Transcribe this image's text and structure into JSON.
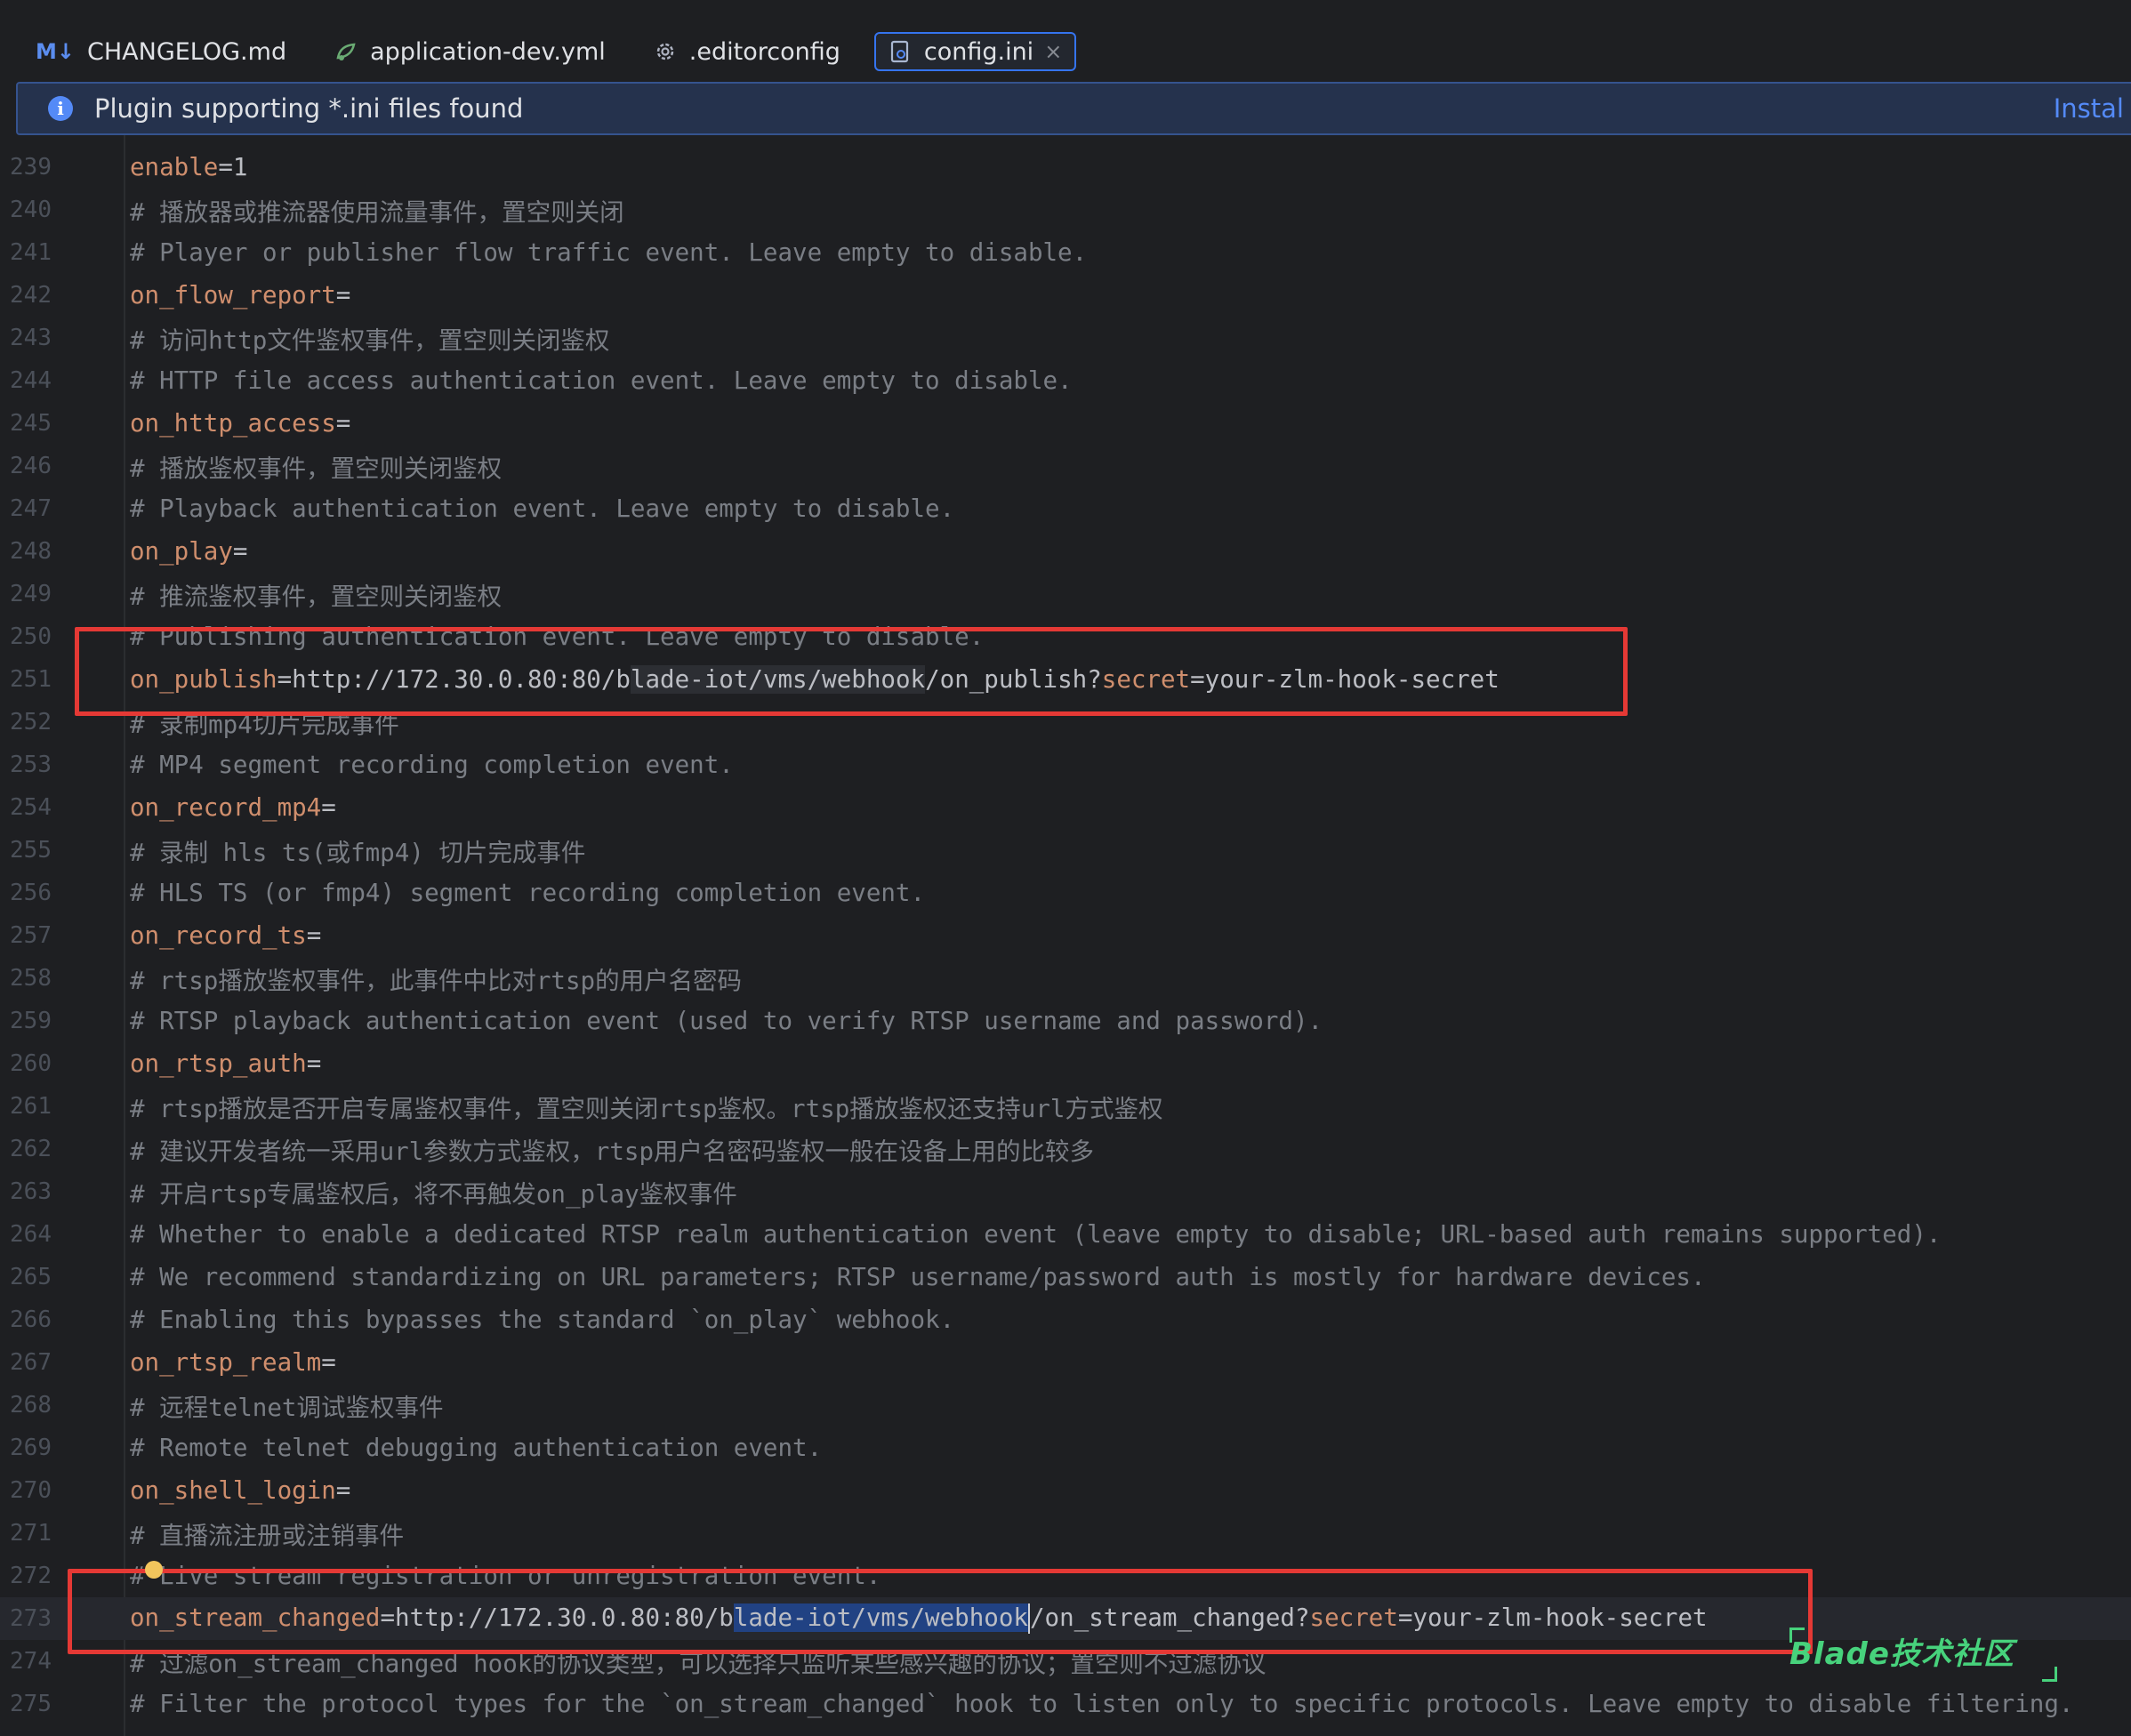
{
  "tabs": [
    {
      "label": "CHANGELOG.md",
      "icon": "markdown-icon",
      "icon_text": "M↓",
      "active": false
    },
    {
      "label": "application-dev.yml",
      "icon": "yaml-icon",
      "icon_text": "",
      "active": false
    },
    {
      "label": ".editorconfig",
      "icon": "gear-icon",
      "icon_text": "",
      "active": false
    },
    {
      "label": "config.ini",
      "icon": "ini-file-icon",
      "icon_text": "",
      "active": true
    }
  ],
  "banner": {
    "message": "Plugin supporting *.ini files found",
    "action": "Instal"
  },
  "lines": [
    {
      "n": "239",
      "key": "enable",
      "val": "=1"
    },
    {
      "n": "240",
      "comment": "# 播放器或推流器使用流量事件，置空则关闭"
    },
    {
      "n": "241",
      "comment": "# Player or publisher flow traffic event. Leave empty to disable."
    },
    {
      "n": "242",
      "key": "on_flow_report",
      "val": "="
    },
    {
      "n": "243",
      "comment": "# 访问http文件鉴权事件，置空则关闭鉴权"
    },
    {
      "n": "244",
      "comment": "# HTTP file access authentication event. Leave empty to disable."
    },
    {
      "n": "245",
      "key": "on_http_access",
      "val": "="
    },
    {
      "n": "246",
      "comment": "# 播放鉴权事件，置空则关闭鉴权"
    },
    {
      "n": "247",
      "comment": "# Playback authentication event. Leave empty to disable."
    },
    {
      "n": "248",
      "key": "on_play",
      "val": "="
    },
    {
      "n": "249",
      "comment": "# 推流鉴权事件，置空则关闭鉴权"
    },
    {
      "n": "250",
      "comment": "# Publishing authentication event. Leave empty to disable."
    },
    {
      "n": "251",
      "key": "on_publish",
      "url_a": "=http://172.30.0.80:80/b",
      "url_sel": "lade-iot/vms/webhook",
      "url_b": "/on_publish?",
      "param": "secret",
      "param_val": "=your-zlm-hook-secret",
      "sel": "s1"
    },
    {
      "n": "252",
      "comment": "# 录制mp4切片完成事件"
    },
    {
      "n": "253",
      "comment": "# MP4 segment recording completion event."
    },
    {
      "n": "254",
      "key": "on_record_mp4",
      "val": "="
    },
    {
      "n": "255",
      "comment": "# 录制 hls ts(或fmp4) 切片完成事件"
    },
    {
      "n": "256",
      "comment": "# HLS TS (or fmp4) segment recording completion event."
    },
    {
      "n": "257",
      "key": "on_record_ts",
      "val": "="
    },
    {
      "n": "258",
      "comment": "# rtsp播放鉴权事件，此事件中比对rtsp的用户名密码"
    },
    {
      "n": "259",
      "comment": "# RTSP playback authentication event (used to verify RTSP username and password)."
    },
    {
      "n": "260",
      "key": "on_rtsp_auth",
      "val": "="
    },
    {
      "n": "261",
      "comment": "# rtsp播放是否开启专属鉴权事件，置空则关闭rtsp鉴权。rtsp播放鉴权还支持url方式鉴权"
    },
    {
      "n": "262",
      "comment": "# 建议开发者统一采用url参数方式鉴权，rtsp用户名密码鉴权一般在设备上用的比较多"
    },
    {
      "n": "263",
      "comment": "# 开启rtsp专属鉴权后，将不再触发on_play鉴权事件"
    },
    {
      "n": "264",
      "comment": "# Whether to enable a dedicated RTSP realm authentication event (leave empty to disable; URL-based auth remains supported)."
    },
    {
      "n": "265",
      "comment": "# We recommend standardizing on URL parameters; RTSP username/password auth is mostly for hardware devices."
    },
    {
      "n": "266",
      "comment": "# Enabling this bypasses the standard `on_play` webhook."
    },
    {
      "n": "267",
      "key": "on_rtsp_realm",
      "val": "="
    },
    {
      "n": "268",
      "comment": "# 远程telnet调试鉴权事件"
    },
    {
      "n": "269",
      "comment": "# Remote telnet debugging authentication event."
    },
    {
      "n": "270",
      "key": "on_shell_login",
      "val": "="
    },
    {
      "n": "271",
      "comment": "# 直播流注册或注销事件"
    },
    {
      "n": "272",
      "comment": "# Live stream registration or unregistration event."
    },
    {
      "n": "273",
      "key": "on_stream_changed",
      "url_a": "=http://172.30.0.80:80/b",
      "url_sel": "lade-iot/vms/webhook",
      "url_b": "/on_stream_changed?",
      "param": "secret",
      "param_val": "=your-zlm-hook-secret",
      "sel": "s2",
      "caret": true
    },
    {
      "n": "274",
      "comment": "# 过滤on_stream_changed hook的协议类型，可以选择只监听某些感兴趣的协议；置空则不过滤协议"
    },
    {
      "n": "275",
      "comment": "# Filter the protocol types for the `on_stream_changed` hook to listen only to specific protocols. Leave empty to disable filtering."
    }
  ],
  "watermark": "Blade技术社区",
  "colors": {
    "background": "#1e1f22",
    "key": "#cf8e6d",
    "comment": "#7a7e85",
    "text": "#bcbec4",
    "highlight_box": "#e53935",
    "accent": "#3574f0"
  }
}
